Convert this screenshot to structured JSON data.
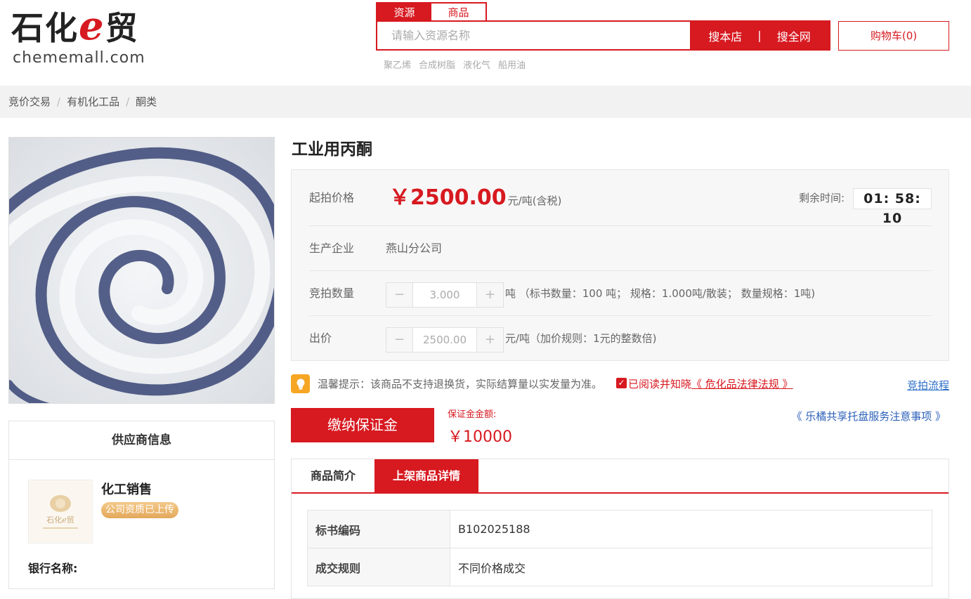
{
  "logo": {
    "main_prefix": "石化",
    "main_e": "e",
    "main_suffix": "贸",
    "sub": "chememall.com"
  },
  "search": {
    "tabs": [
      "资源",
      "商品"
    ],
    "placeholder": "请输入资源名称",
    "btn_store": "搜本店",
    "separator": "|",
    "btn_all": "搜全网",
    "hot_words": [
      "聚乙烯",
      "合成树脂",
      "液化气",
      "船用油"
    ]
  },
  "cart": {
    "label": "购物车(0)"
  },
  "breadcrumb": [
    "竞价交易",
    "有机化工品",
    "酮类"
  ],
  "supplier": {
    "title": "供应商信息",
    "logo_text_prefix": "石化",
    "logo_text_e": "e",
    "logo_text_suffix": "贸",
    "name": "化工销售",
    "badge": "公司资质已上传",
    "bank_label": "银行名称:"
  },
  "product": {
    "title": "工业用丙酮",
    "start_price_label": "起拍价格",
    "start_price": "￥2500.00",
    "price_unit": "元/吨(含税)",
    "countdown_label": "剩余时间:",
    "countdown": "01: 58: 10",
    "producer_label": "生产企业",
    "producer": "燕山分公司",
    "quantity_label": "竞拍数量",
    "quantity": "3.000",
    "quantity_note": "吨 （标书数量：100 吨；  规格：1.000吨/散装；  数量规格：1吨)",
    "bid_label": "出价",
    "bid": "2500.00",
    "bid_note": "元/吨（加价规则：1元的整数倍)",
    "minus": "−",
    "plus": "+"
  },
  "tip": {
    "text": "温馨提示：该商品不支持退换货，实际结算量以实发量为准。",
    "check": "✓",
    "agree_prefix": "已阅读并知晓",
    "agree_link": "《 危化品法律法规 》",
    "process_link": "竞拍流程"
  },
  "deposit": {
    "button": "缴纳保证金",
    "amount_label": "保证金金额:",
    "amount": "￥10000",
    "notice_link": "《 乐橘共享托盘服务注意事项 》"
  },
  "tabs": [
    "商品简介",
    "上架商品详情"
  ],
  "details": [
    {
      "key": "标书编码",
      "value": "B102025188"
    },
    {
      "key": "成交规则",
      "value": "不同价格成交"
    }
  ],
  "colors": {
    "accent": "#d71920",
    "link": "#2a6fc9",
    "tip_icon": "#f6a623"
  }
}
